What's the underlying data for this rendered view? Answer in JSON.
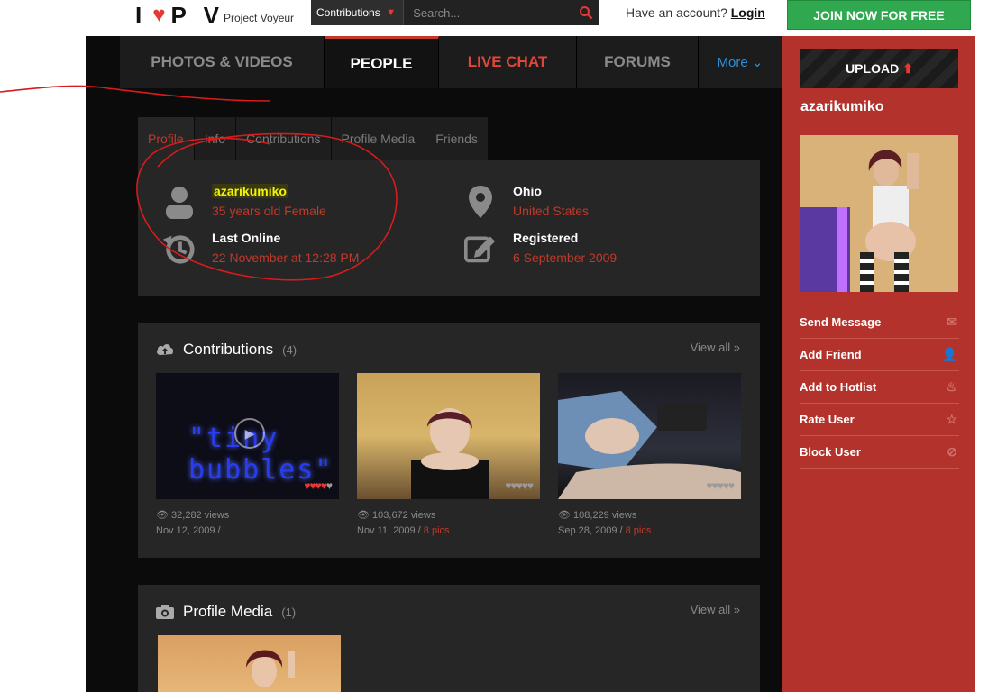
{
  "header": {
    "logo_letters": "P V",
    "logo_heart": "♥",
    "logo_i": "I",
    "logo_subtitle": "Project Voyeur",
    "search": {
      "category": "Contributions",
      "placeholder": "Search..."
    },
    "account_prompt": "Have an account?",
    "login_label": "Login",
    "join_label": "JOIN NOW FOR FREE"
  },
  "nav": {
    "items": [
      {
        "label": "PHOTOS & VIDEOS"
      },
      {
        "label": "PEOPLE"
      },
      {
        "label": "LIVE CHAT"
      },
      {
        "label": "FORUMS"
      },
      {
        "label": "More ⌄"
      }
    ]
  },
  "profile_tabs": [
    "Profile",
    "Info",
    "Contributions",
    "Profile Media",
    "Friends"
  ],
  "profile": {
    "username": "azarikumiko",
    "age_gender": "35 years old Female",
    "last_online_label": "Last Online",
    "last_online": "22 November at 12:28 PM",
    "location_city": "Ohio",
    "location_country": "United States",
    "registered_label": "Registered",
    "registered": "6 September 2009"
  },
  "contributions": {
    "title": "Contributions",
    "count": "(4)",
    "view_all": "View all »",
    "items": [
      {
        "views": "32,282 views",
        "date": "Nov 12, 2009 /",
        "pics": "",
        "thumb_text": "\"tiny bubbles\""
      },
      {
        "views": "103,672 views",
        "date": "Nov 11, 2009 /",
        "pics": "8 pics"
      },
      {
        "views": "108,229 views",
        "date": "Sep 28, 2009 /",
        "pics": "8 pics"
      }
    ]
  },
  "profile_media": {
    "title": "Profile Media",
    "count": "(1)",
    "view_all": "View all »"
  },
  "sidebar": {
    "upload_label": "UPLOAD",
    "username": "azarikumiko",
    "actions": [
      {
        "label": "Send Message",
        "icon": "envelope-icon"
      },
      {
        "label": "Add Friend",
        "icon": "add-user-icon"
      },
      {
        "label": "Add to Hotlist",
        "icon": "flame-icon"
      },
      {
        "label": "Rate User",
        "icon": "star-icon"
      },
      {
        "label": "Block User",
        "icon": "block-icon"
      }
    ]
  },
  "colors": {
    "accent": "#c0392b",
    "join": "#2fa84f",
    "sidebar": "#b3322b",
    "link_blue": "#2e8fd6"
  }
}
